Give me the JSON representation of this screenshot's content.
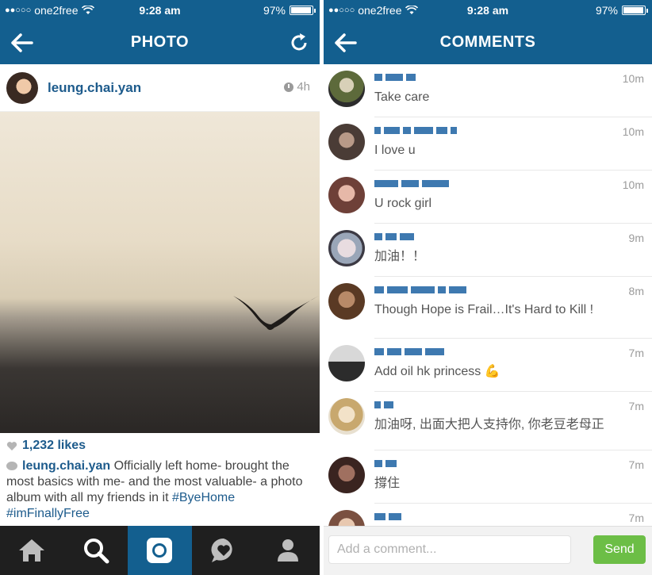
{
  "status_bar": {
    "carrier": "one2free",
    "time": "9:28 am",
    "battery": "97%",
    "battery_level": 0.97
  },
  "photo_screen": {
    "title": "PHOTO",
    "username": "leung.chai.yan",
    "age": "4h",
    "likes": "1,232 likes",
    "caption": {
      "user": "leung.chai.yan",
      "text": " Officially left home- brought the most basics with me- and the most valuable- a photo album with all my friends in it ",
      "tags": [
        "#ByeHome",
        "#imFinallyFree"
      ]
    },
    "tabs": [
      "home",
      "explore",
      "camera",
      "activity",
      "profile"
    ]
  },
  "comments_screen": {
    "title": "COMMENTS",
    "comments": [
      {
        "time": "10m",
        "text": "Take care"
      },
      {
        "time": "10m",
        "text": "I love u"
      },
      {
        "time": "10m",
        "text": "U rock girl"
      },
      {
        "time": "9m",
        "text": "加油！！"
      },
      {
        "time": "8m",
        "text": "Though Hope is Frail…It's Hard to Kill !"
      },
      {
        "time": "7m",
        "text": "Add oil hk princess 💪"
      },
      {
        "time": "7m",
        "text": "加油呀, 出面大把人支持你, 你老豆老母正"
      },
      {
        "time": "7m",
        "text": "撐住"
      },
      {
        "time": "7m",
        "text": ""
      }
    ],
    "input_placeholder": "Add a comment...",
    "send_label": "Send"
  },
  "colors": {
    "header": "#135f8f",
    "link": "#1d5b8c",
    "send": "#6cbe46",
    "tabbar": "#1f1f1f"
  },
  "icons": [
    "back-arrow-icon",
    "refresh-icon",
    "clock-icon",
    "heart-icon",
    "comment-bubble-icon",
    "home-icon",
    "search-icon",
    "camera-icon",
    "activity-icon",
    "profile-icon",
    "wifi-icon",
    "battery-icon"
  ]
}
